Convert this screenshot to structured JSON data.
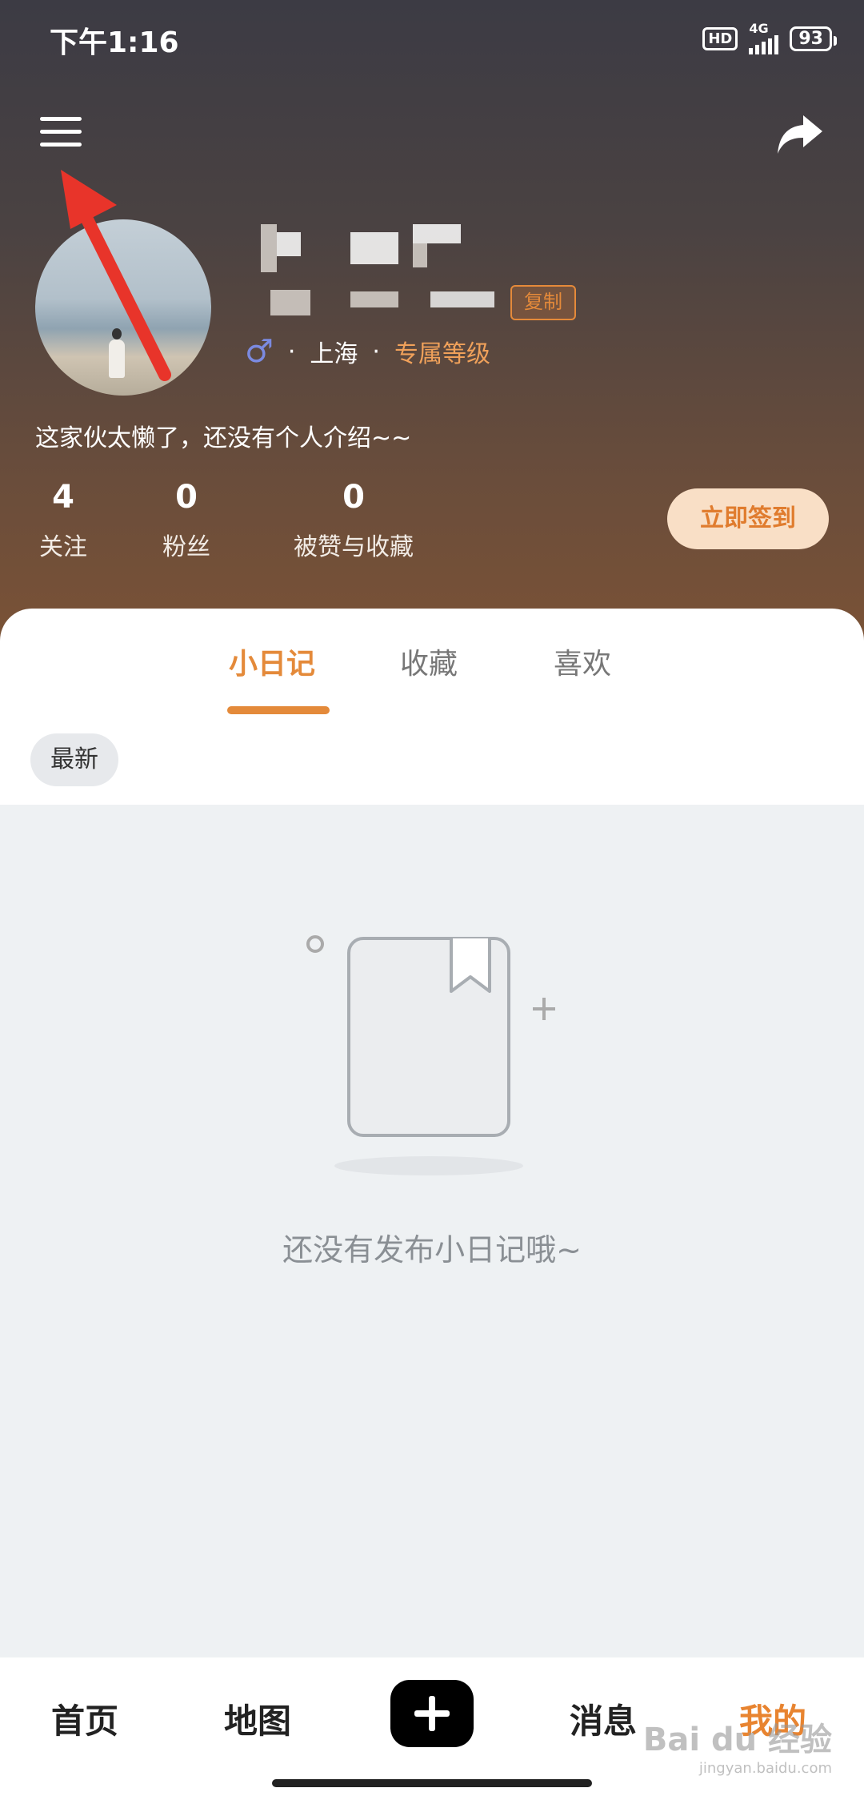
{
  "status_bar": {
    "time": "下午1:16",
    "hd": "HD",
    "network": "4G",
    "battery": "93"
  },
  "header": {
    "copy_label": "复制",
    "location": "上海",
    "level_link": "专属等级",
    "separator": "·",
    "bio": "这家伙太懒了，还没有个人介绍~~",
    "gender_symbol": "♂"
  },
  "stats": [
    {
      "value": "4",
      "label": "关注"
    },
    {
      "value": "0",
      "label": "粉丝"
    },
    {
      "value": "0",
      "label": "被赞与收藏"
    }
  ],
  "checkin_label": "立即签到",
  "tabs": [
    {
      "label": "小日记",
      "active": true
    },
    {
      "label": "收藏",
      "active": false
    },
    {
      "label": "喜欢",
      "active": false
    }
  ],
  "filter_chip": "最新",
  "empty_text": "还没有发布小日记哦~",
  "bottom_nav": [
    {
      "label": "首页"
    },
    {
      "label": "地图"
    },
    {
      "label": "消息"
    },
    {
      "label": "我的",
      "active": true
    }
  ],
  "watermark": {
    "brand": "Bai du 经验",
    "url": "jingyan.baidu.com"
  },
  "colors": {
    "accent": "#e48a3a",
    "annotation_arrow": "#e8342a"
  }
}
